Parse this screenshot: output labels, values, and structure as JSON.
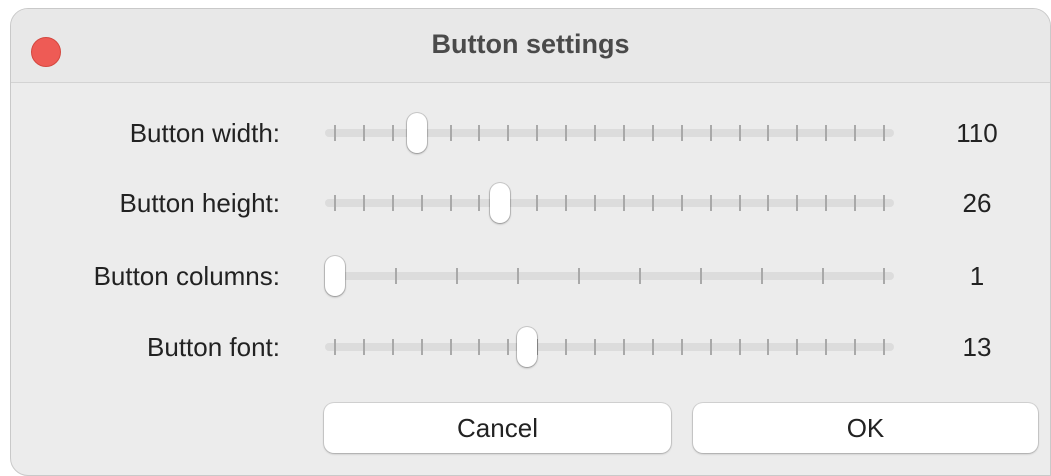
{
  "window": {
    "title": "Button settings"
  },
  "sliders": [
    {
      "label": "Button width:",
      "value": "110",
      "ticks": 20,
      "position": 0.15,
      "snap": "tick"
    },
    {
      "label": "Button height:",
      "value": "26",
      "ticks": 20,
      "position": 0.3,
      "snap": "tick"
    },
    {
      "label": "Button columns:",
      "value": "1",
      "ticks": 10,
      "position": 0.0,
      "snap": "tick"
    },
    {
      "label": "Button font:",
      "value": "13",
      "ticks": 20,
      "position": 0.35,
      "snap": "tick"
    }
  ],
  "buttons": {
    "cancel_label": "Cancel",
    "ok_label": "OK"
  },
  "colors": {
    "close": "#ee5b55",
    "window_bg": "#ececec",
    "track": "#dcdcdc",
    "tick": "#a9a9a9"
  }
}
